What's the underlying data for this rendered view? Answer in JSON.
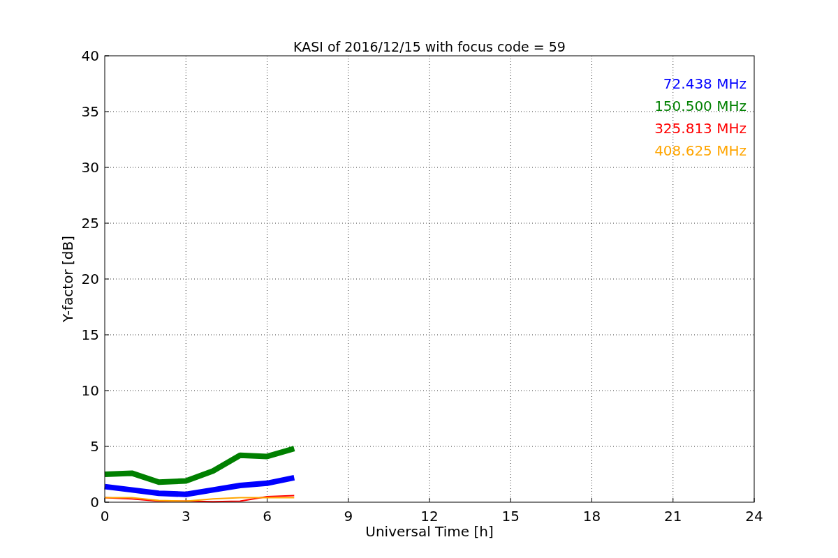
{
  "figure": {
    "chart_data": {
      "type": "line",
      "title": "KASI of 2016/12/15 with focus code = 59",
      "xlabel": "Universal Time [h]",
      "ylabel": "Y-factor [dB]",
      "x": [
        0,
        1,
        2,
        3,
        4,
        5,
        6,
        7
      ],
      "series": [
        {
          "name": "72.438 MHz",
          "color": "#0000ff",
          "values": [
            1.4,
            1.1,
            0.8,
            0.7,
            1.1,
            1.5,
            1.7,
            2.2
          ]
        },
        {
          "name": "150.500 MHz",
          "color": "#008000",
          "values": [
            2.5,
            2.6,
            1.8,
            1.9,
            2.8,
            4.2,
            4.1,
            4.8
          ]
        },
        {
          "name": "325.813 MHz",
          "color": "#ff0000",
          "values": [
            0.4,
            0.3,
            0.1,
            0.1,
            0.05,
            0.1,
            0.5,
            0.6
          ]
        },
        {
          "name": "408.625 MHz",
          "color": "#ffa500",
          "values": [
            0.4,
            0.4,
            0.15,
            0.1,
            0.3,
            0.4,
            0.4,
            0.4
          ]
        }
      ],
      "xlim": [
        0,
        24
      ],
      "ylim": [
        0,
        40
      ],
      "xticks": [
        0,
        3,
        6,
        9,
        12,
        15,
        18,
        21,
        24
      ],
      "yticks": [
        0,
        5,
        10,
        15,
        20,
        25,
        30,
        35,
        40
      ],
      "grid": true
    }
  }
}
